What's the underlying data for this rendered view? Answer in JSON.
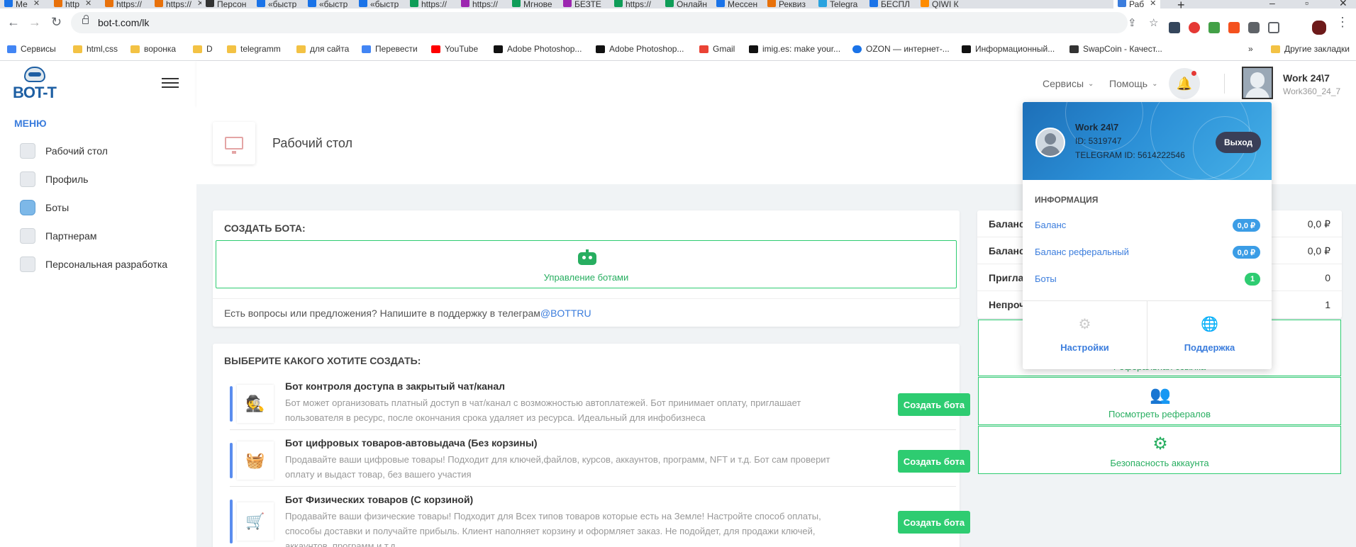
{
  "browser": {
    "tabs": [
      {
        "label": "Ме",
        "color": "#1a73e8"
      },
      {
        "label": "http",
        "color": "#e8710a"
      },
      {
        "label": "https://",
        "color": "#e8710a"
      },
      {
        "label": "Персон",
        "color": "#333333"
      },
      {
        "label": "«быстр",
        "color": "#1a73e8"
      },
      {
        "label": "«быстр",
        "color": "#1a73e8"
      },
      {
        "label": "«быстр",
        "color": "#1a73e8"
      },
      {
        "label": "https://",
        "color": "#0f9d58"
      },
      {
        "label": "https://",
        "color": "#9c27b0"
      },
      {
        "label": "Мгнове",
        "color": "#0f9d58"
      },
      {
        "label": "БЕЗТЕ",
        "color": "#9c27b0"
      },
      {
        "label": "https://",
        "color": "#0f9d58"
      },
      {
        "label": "Онлайн",
        "color": "#0f9d58"
      },
      {
        "label": "Мессен",
        "color": "#1a73e8"
      },
      {
        "label": "Реквиз",
        "color": "#e8710a"
      },
      {
        "label": "Telegra",
        "color": "#2aa3df"
      },
      {
        "label": "БЕСПЛ",
        "color": "#1a73e8"
      },
      {
        "label": "QIWI К",
        "color": "#ff8c00"
      },
      {
        "label": "Раб",
        "color": "#3b7ddd"
      }
    ],
    "url": "bot-t.com/lk",
    "more_bookmarks": "»",
    "other_bookmarks": "Другие закладки",
    "bookmarks": [
      {
        "label": "Сервисы",
        "color": "#4285f4"
      },
      {
        "label": "html,css",
        "color": "#f3c244"
      },
      {
        "label": "воронка",
        "color": "#f3c244"
      },
      {
        "label": "D",
        "color": "#f3c244"
      },
      {
        "label": "telegramm",
        "color": "#f3c244"
      },
      {
        "label": "для сайта",
        "color": "#f3c244"
      },
      {
        "label": "Перевести",
        "color": "#4285f4"
      },
      {
        "label": "YouTube",
        "color": "#ff0000"
      },
      {
        "label": "Adobe Photoshop...",
        "color": "#111111"
      },
      {
        "label": "Adobe Photoshop...",
        "color": "#111111"
      },
      {
        "label": "Gmail",
        "color": "#ea4335"
      },
      {
        "label": "imig.es: make your...",
        "color": "#111111"
      },
      {
        "label": "OZON — интернет-...",
        "color": "#1a73e8"
      },
      {
        "label": "Информационный...",
        "color": "#111111"
      },
      {
        "label": "SwapCoin - Качест...",
        "color": "#333333"
      }
    ]
  },
  "sidebar": {
    "logo_text": "BOT-T",
    "menu_title": "МЕНЮ",
    "items": [
      {
        "label": "Рабочий стол",
        "icon": "bell-icon"
      },
      {
        "label": "Профиль",
        "icon": "profile-icon"
      },
      {
        "label": "Боты",
        "icon": "robot-icon"
      },
      {
        "label": "Партнерам",
        "icon": "partners-icon"
      },
      {
        "label": "Персональная разработка",
        "icon": "building-icon"
      }
    ]
  },
  "topbar": {
    "services": "Сервисы",
    "help": "Помощь",
    "user_name": "Work 24\\7",
    "user_login": "Work360_24_7"
  },
  "page": {
    "title": "Рабочий стол"
  },
  "create_card": {
    "title": "СОЗДАТЬ БОТА:",
    "manage_label": "Управление ботами",
    "support_text": "Есть вопросы или предложения? Напишите в поддержку в телеграм",
    "support_link": "@BOTTRU"
  },
  "choose_card": {
    "title": "ВЫБЕРИТЕ КАКОГО ХОТИТЕ СОЗДАТЬ:",
    "bots": [
      {
        "title": "Бот контроля доступа в закрытый чат/канал",
        "desc": "Бот может организовать платный доступ в чат/канал с возможностью автоплатежей. Бот принимает оплату, приглашает пользователя в ресурс, после окончания срока удаляет из ресурса. Идеальный для инфобизнеса",
        "button": "Создать бота",
        "icon": "spy-icon"
      },
      {
        "title": "Бот цифровых товаров-автовыдача (Без корзины)",
        "desc": "Продавайте ваши цифровые товары! Подходит для ключей,файлов, курсов, аккаунтов, программ, NFT и т.д. Бот сам проверит оплату и выдаст товар, без вашего участия",
        "button": "Создать бота",
        "icon": "basket-icon"
      },
      {
        "title": "Бот Физических товаров (С корзиной)",
        "desc": "Продавайте ваши физические товары! Подходит для Всех типов товаров которые есть на Земле! Настройте способ оплаты, способы доставки и получайте прибыль. Клиент наполняет корзину и оформляет заказ. Не подойдет, для продажи ключей, аккаунтов, программ и т.д.",
        "button": "Создать бота",
        "icon": "cart-plus-icon"
      }
    ]
  },
  "stats": [
    {
      "key": "Баланс",
      "value": "0,0 ₽"
    },
    {
      "key": "Баланс",
      "value": "0,0 ₽"
    },
    {
      "key": "Пригла",
      "value": "0"
    },
    {
      "key": "Непроч",
      "value": "1"
    }
  ],
  "actions": {
    "hidden_label": "Реферальная ссылка",
    "referrals": "Посмотреть рефералов",
    "security": "Безопасность аккаунта"
  },
  "dropdown": {
    "name": "Work 24\\7",
    "id": "ID: 5319747",
    "telegram": "TELEGRAM ID: 5614222546",
    "logout": "Выход",
    "info_title": "ИНФОРМАЦИЯ",
    "rows": [
      {
        "label": "Баланс",
        "badge": "0,0 ₽",
        "color": "#3b9de6"
      },
      {
        "label": "Баланс реферальный",
        "badge": "0,0 ₽",
        "color": "#3b9de6"
      },
      {
        "label": "Боты",
        "badge": "1",
        "color": "#2ecc71"
      }
    ],
    "settings": "Настройки",
    "support": "Поддержка"
  }
}
